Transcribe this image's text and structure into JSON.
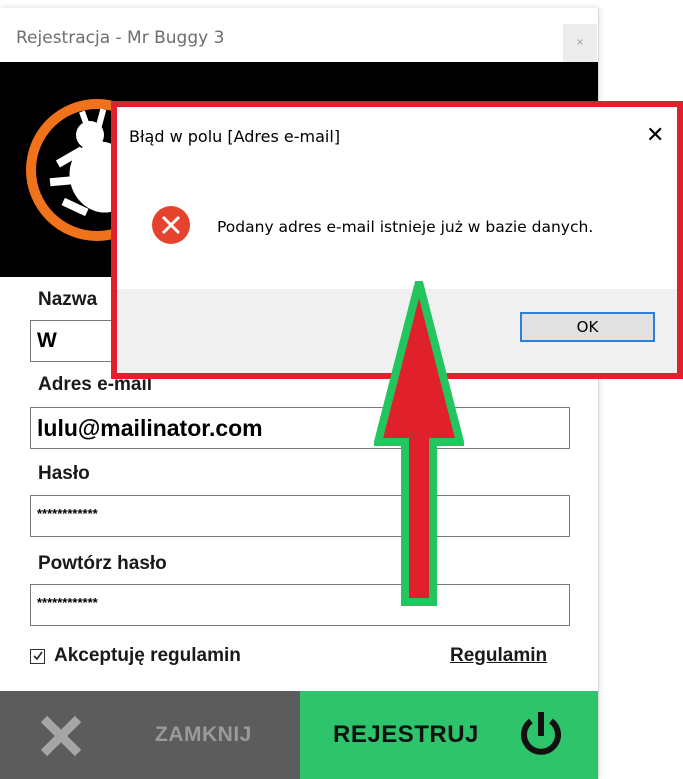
{
  "window": {
    "title": "Rejestracja - Mr Buggy 3",
    "close_glyph": "×"
  },
  "form": {
    "name_label": "Nazwa",
    "name_value": "W",
    "email_label": "Adres e-mail",
    "email_value": "lulu@mailinator.com",
    "password_label": "Hasło",
    "password_value": "************",
    "repeat_password_label": "Powtórz hasło",
    "repeat_password_value": "************",
    "accept_label": "Akceptuję regulamin",
    "accept_checked": true,
    "terms_link": "Regulamin"
  },
  "footer": {
    "close_label": "ZAMKNIJ",
    "register_label": "REJESTRUJ"
  },
  "dialog": {
    "title": "Błąd w polu [Adres e-mail]",
    "message": "Podany adres e-mail istnieje już w bazie danych.",
    "ok_label": "OK",
    "close_glyph": "✕"
  },
  "colors": {
    "header_bg": "#000000",
    "logo_orange": "#f0731c",
    "close_bg": "#5c5c5c",
    "register_bg": "#2ec46c",
    "dialog_border": "#e0202a",
    "error_icon": "#e6432f",
    "ok_border": "#2e7fd6",
    "arrow_fill": "#e0202a",
    "arrow_outline": "#22c55e"
  },
  "icons": {
    "logo": "bug-logo-icon",
    "error": "error-circle-icon",
    "close": "x-icon",
    "register": "power-icon",
    "annotation": "up-arrow-icon"
  }
}
